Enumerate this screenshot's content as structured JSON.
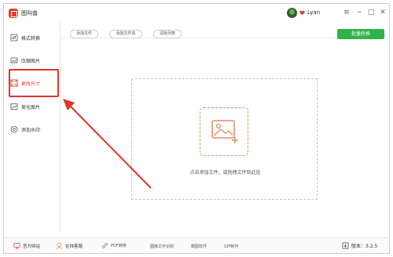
{
  "app": {
    "title": "图叫兽",
    "user_name": "Lyan"
  },
  "window_controls": [
    "≡",
    "−",
    "□",
    "✕"
  ],
  "sidebar": {
    "items": [
      {
        "label": "格式转换",
        "icon": "format-convert-icon"
      },
      {
        "label": "压缩图片",
        "icon": "compress-icon"
      },
      {
        "label": "更改尺寸",
        "icon": "resize-icon",
        "active": true
      },
      {
        "label": "美化图片",
        "icon": "beautify-icon"
      },
      {
        "label": "添加水印",
        "icon": "watermark-icon"
      }
    ]
  },
  "toolbar": {
    "add_file": "添加文件",
    "add_folder": "添加文件夹",
    "clear_list": "清除列表",
    "batch_convert": "批量转换"
  },
  "dropzone": {
    "hint": "点击添加文件，或拖拽文件到此处"
  },
  "statusbar": {
    "website": "官方网站",
    "online_service": "在线客服",
    "pdf_convert": "PDF转换",
    "ocr": "图像文字识别",
    "screenshot": "截图软件",
    "gif": "GIF制作",
    "version": "版本：3.2.5"
  },
  "colors": {
    "accent": "#e0412d",
    "batch_button": "#2fb24a",
    "annotation": "#e0342a"
  }
}
